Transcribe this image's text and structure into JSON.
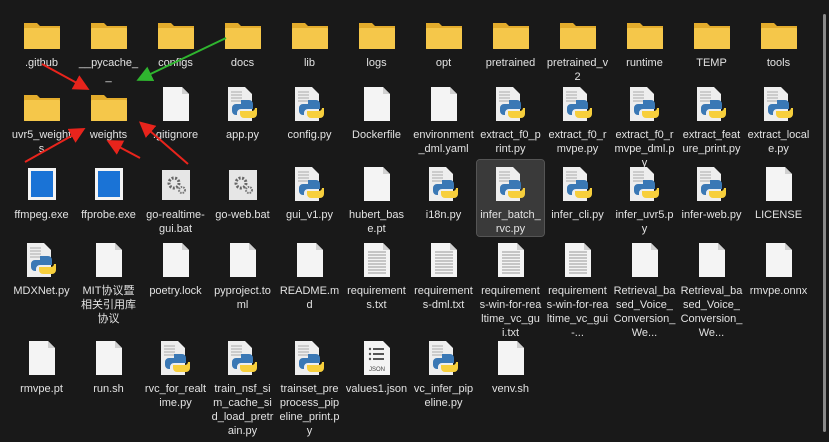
{
  "rows": [
    [
      {
        "name": ".github",
        "type": "folder"
      },
      {
        "name": "__pycache__",
        "type": "folder"
      },
      {
        "name": "configs",
        "type": "folder"
      },
      {
        "name": "docs",
        "type": "folder"
      },
      {
        "name": "lib",
        "type": "folder"
      },
      {
        "name": "logs",
        "type": "folder"
      },
      {
        "name": "opt",
        "type": "folder"
      },
      {
        "name": "pretrained",
        "type": "folder"
      },
      {
        "name": "pretrained_v2",
        "type": "folder"
      },
      {
        "name": "runtime",
        "type": "folder"
      },
      {
        "name": "TEMP",
        "type": "folder"
      },
      {
        "name": "tools",
        "type": "folder"
      }
    ],
    [
      {
        "name": "uvr5_weights",
        "type": "folder"
      },
      {
        "name": "weights",
        "type": "folder"
      },
      {
        "name": ".gitignore",
        "type": "file"
      },
      {
        "name": "app.py",
        "type": "python"
      },
      {
        "name": "config.py",
        "type": "python"
      },
      {
        "name": "Dockerfile",
        "type": "file"
      },
      {
        "name": "environment_dml.yaml",
        "type": "file"
      },
      {
        "name": "extract_f0_print.py",
        "type": "python"
      },
      {
        "name": "extract_f0_rmvpe.py",
        "type": "python"
      },
      {
        "name": "extract_f0_rmvpe_dml.py",
        "type": "python"
      },
      {
        "name": "extract_feature_print.py",
        "type": "python"
      },
      {
        "name": "extract_locale.py",
        "type": "python"
      }
    ],
    [
      {
        "name": "ffmpeg.exe",
        "type": "exe"
      },
      {
        "name": "ffprobe.exe",
        "type": "exe"
      },
      {
        "name": "go-realtime-gui.bat",
        "type": "bat"
      },
      {
        "name": "go-web.bat",
        "type": "bat"
      },
      {
        "name": "gui_v1.py",
        "type": "python"
      },
      {
        "name": "hubert_base.pt",
        "type": "file"
      },
      {
        "name": "i18n.py",
        "type": "python"
      },
      {
        "name": "infer_batch_rvc.py",
        "type": "python",
        "selected": true
      },
      {
        "name": "infer_cli.py",
        "type": "python"
      },
      {
        "name": "infer_uvr5.py",
        "type": "python"
      },
      {
        "name": "infer-web.py",
        "type": "python"
      },
      {
        "name": "LICENSE",
        "type": "file"
      }
    ],
    [
      {
        "name": "MDXNet.py",
        "type": "python"
      },
      {
        "name": "MIT协议暨相关引用库协议",
        "type": "file"
      },
      {
        "name": "poetry.lock",
        "type": "file"
      },
      {
        "name": "pyproject.toml",
        "type": "file"
      },
      {
        "name": "README.md",
        "type": "file"
      },
      {
        "name": "requirements.txt",
        "type": "text"
      },
      {
        "name": "requirements-dml.txt",
        "type": "text"
      },
      {
        "name": "requirements-win-for-realtime_vc_gui.txt",
        "type": "text"
      },
      {
        "name": "requirements-win-for-realtime_vc_gui-...",
        "type": "text"
      },
      {
        "name": "Retrieval_based_Voice_Conversion_We...",
        "type": "file"
      },
      {
        "name": "Retrieval_based_Voice_Conversion_We...",
        "type": "file"
      },
      {
        "name": "rmvpe.onnx",
        "type": "file"
      }
    ],
    [
      {
        "name": "rmvpe.pt",
        "type": "file"
      },
      {
        "name": "run.sh",
        "type": "file"
      },
      {
        "name": "rvc_for_realtime.py",
        "type": "python"
      },
      {
        "name": "train_nsf_sim_cache_sid_load_pretrain.py",
        "type": "python"
      },
      {
        "name": "trainset_preprocess_pipeline_print.py",
        "type": "python"
      },
      {
        "name": "values1.json",
        "type": "json",
        "badge": "JSON"
      },
      {
        "name": "vc_infer_pipeline.py",
        "type": "python"
      },
      {
        "name": "venv.sh",
        "type": "file"
      }
    ]
  ],
  "colors": {
    "folder": "#f5c74a",
    "folder_dark": "#e3ac2c",
    "arrow_red": "#e8241c",
    "arrow_green": "#2fb52f",
    "python_blue": "#3a78b5",
    "python_yellow": "#f7cf3c",
    "exe_blue": "#1a73d6"
  }
}
